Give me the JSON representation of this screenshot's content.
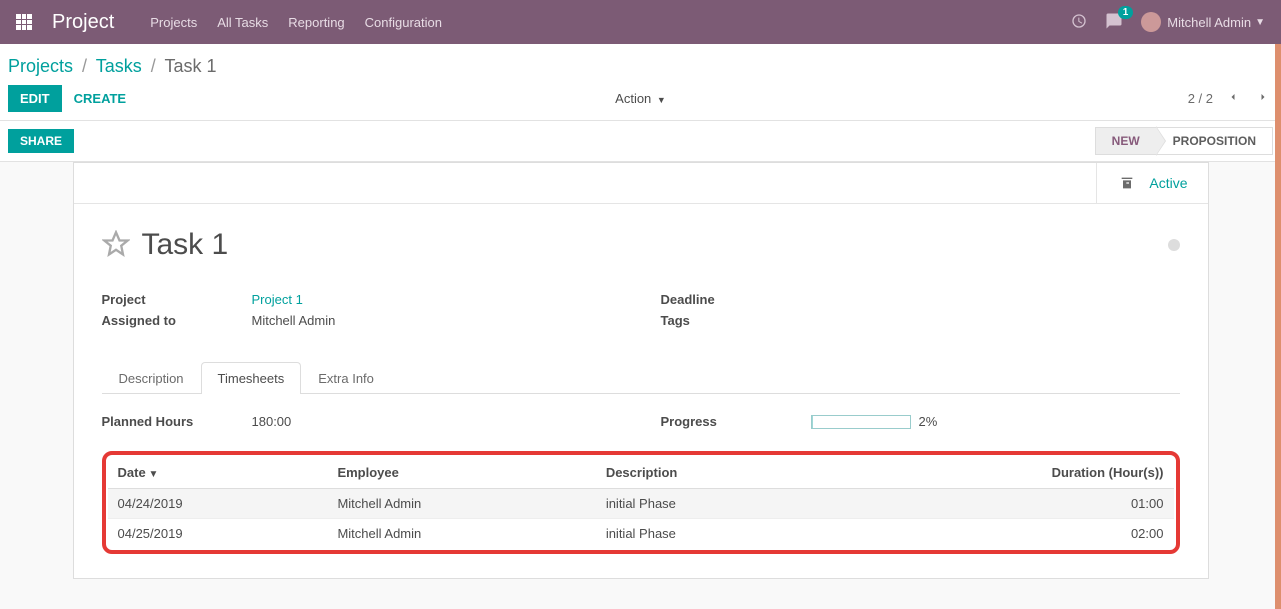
{
  "navbar": {
    "app_title": "Project",
    "menu": [
      "Projects",
      "All Tasks",
      "Reporting",
      "Configuration"
    ],
    "chat_badge": "1",
    "user_name": "Mitchell Admin"
  },
  "breadcrumb": {
    "items": [
      "Projects",
      "Tasks"
    ],
    "current": "Task 1"
  },
  "controls": {
    "edit_label": "EDIT",
    "create_label": "CREATE",
    "action_label": "Action",
    "pager_text": "2 / 2"
  },
  "share_row": {
    "share_label": "SHARE",
    "status_new": "NEW",
    "status_proposition": "PROPOSITION"
  },
  "sheet": {
    "active_label": "Active",
    "task_title": "Task 1",
    "fields": {
      "project_label": "Project",
      "project_value": "Project 1",
      "assigned_label": "Assigned to",
      "assigned_value": "Mitchell Admin",
      "deadline_label": "Deadline",
      "deadline_value": "",
      "tags_label": "Tags",
      "tags_value": ""
    },
    "tabs": {
      "description": "Description",
      "timesheets": "Timesheets",
      "extra_info": "Extra Info"
    },
    "timesheet": {
      "planned_label": "Planned Hours",
      "planned_value": "180:00",
      "progress_label": "Progress",
      "progress_pct": "2%",
      "columns": {
        "date": "Date",
        "employee": "Employee",
        "description": "Description",
        "duration": "Duration (Hour(s))"
      },
      "rows": [
        {
          "date": "04/24/2019",
          "employee": "Mitchell Admin",
          "description": "initial Phase",
          "duration": "01:00"
        },
        {
          "date": "04/25/2019",
          "employee": "Mitchell Admin",
          "description": "initial Phase",
          "duration": "02:00"
        }
      ]
    }
  }
}
